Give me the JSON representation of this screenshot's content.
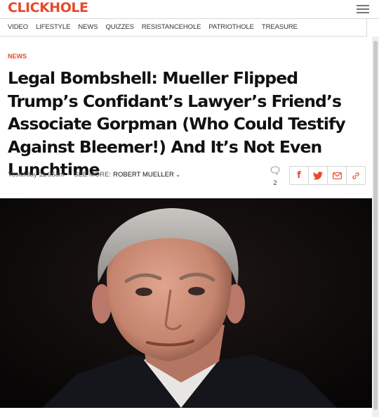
{
  "site": {
    "logo_text": "CLICKHOLE",
    "brand_color": "#e8492c"
  },
  "nav": {
    "items": [
      "Video",
      "Lifestyle",
      "News",
      "Quizzes",
      "ResistanceHole",
      "PatriotHole",
      "Treasure"
    ]
  },
  "article": {
    "category": "News",
    "headline": "Legal Bombshell: Mueller Flipped Trump’s Confidant’s Lawyer’s Friend’s Associate Gorpman (Who Could Testify Against Bleemer!) And It’s Not Even Lunchtime",
    "timestamp": "Yesterday 11:35am",
    "see_more_label": "See more:",
    "see_more_tag": "Robert Mueller",
    "comment_count": "2"
  },
  "share": {
    "icons": [
      "facebook-icon",
      "twitter-icon",
      "email-icon",
      "link-icon"
    ]
  }
}
